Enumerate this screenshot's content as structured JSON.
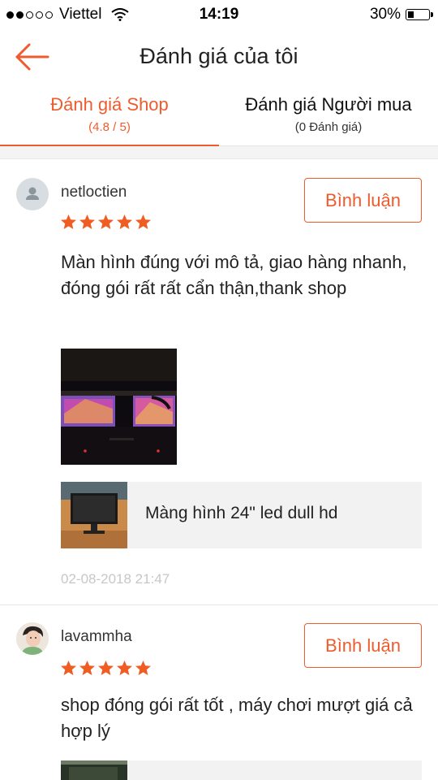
{
  "status_bar": {
    "carrier": "Viettel",
    "time": "14:19",
    "battery": "30%",
    "battery_level": 0.3,
    "signal_bars_filled": 2,
    "signal_bars_total": 5
  },
  "header": {
    "back_icon": "arrow-left-icon",
    "title": "Đánh giá của tôi"
  },
  "tabs": [
    {
      "title": "Đánh giá Shop",
      "subtitle": "(4.8 / 5)",
      "active": true
    },
    {
      "title": "Đánh giá Người mua",
      "subtitle": "(0 Đánh giá)",
      "active": false
    }
  ],
  "colors": {
    "accent": "#ee5c2e",
    "star": "#f05d23",
    "muted": "#c7c7c7",
    "panel": "#f2f2f2"
  },
  "reviews": [
    {
      "username": "netloctien",
      "rating": 5,
      "comment_label": "Bình luận",
      "text": "Màn hình đúng với mô tả, giao hàng nhanh, đóng gói rất rất cẩn thận,thank shop",
      "product_name": "Màng hình 24\" led dull hd",
      "date": "02-08-2018 21:47"
    },
    {
      "username": "lavammha",
      "rating": 5,
      "comment_label": "Bình luận",
      "text": "shop đóng gói rất tốt , máy chơi mượt giá cả hợp lý"
    }
  ]
}
